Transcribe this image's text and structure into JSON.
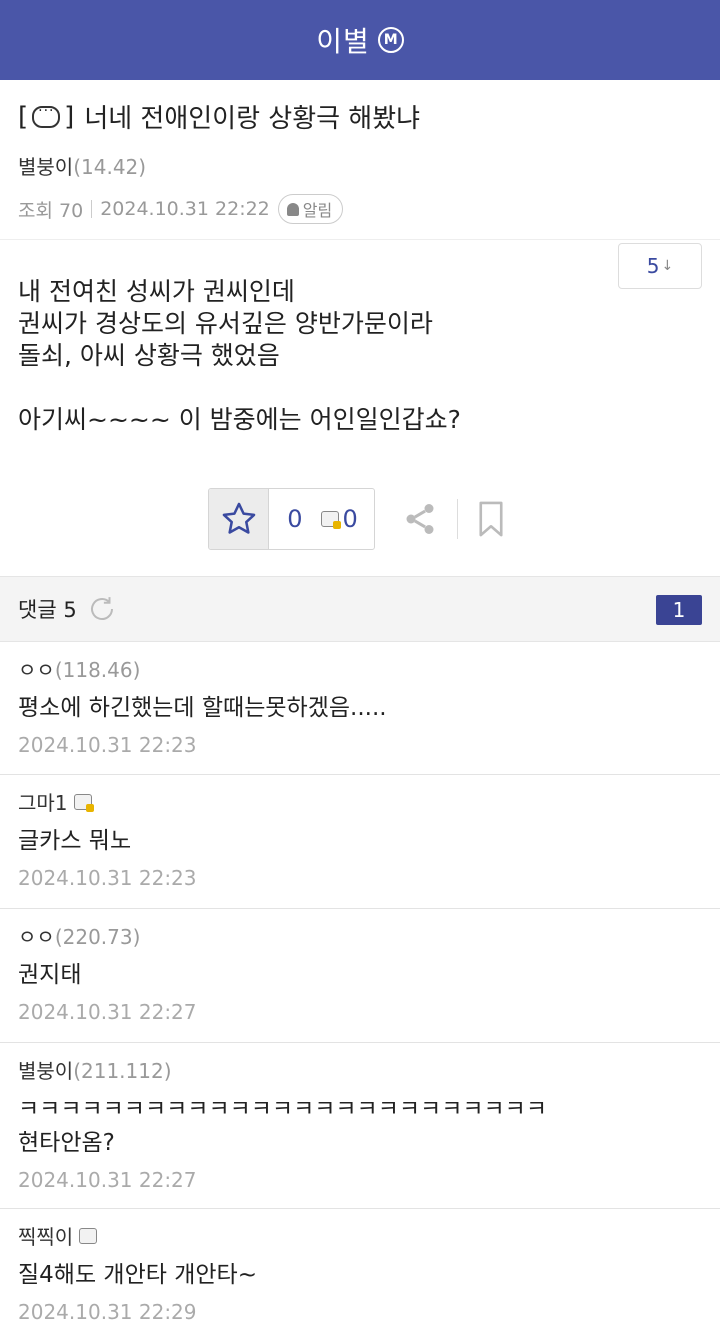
{
  "header": {
    "title": "이별",
    "badge": "M"
  },
  "post": {
    "title_bracket_open": "[",
    "title_bracket_close": "]",
    "title": "너네 전애인이랑 상황극 해봤냐",
    "author": "별붕이",
    "author_ip": "(14.42)",
    "views": "조회 70",
    "datetime": "2024.10.31 22:22",
    "alarm_label": "알림",
    "comment_jump": "5",
    "body_lines": [
      "내 전여친 성씨가 권씨인데",
      "권씨가 경상도의 유서깊은 양반가문이라",
      "돌쇠, 아씨 상황극 했었음"
    ],
    "body_last": "아기씨~~~~ 이 밤중에는 어인일인갑쇼?",
    "recommend_count": "0",
    "fixed_recommend_count": "0"
  },
  "comments_bar": {
    "label": "댓글 5",
    "page": "1"
  },
  "comments": [
    {
      "nick": "ㅇㅇ",
      "ip": "(118.46)",
      "icon": "",
      "text": "평소에 하긴했는데 할때는못하겠음.....",
      "date": "2024.10.31 22:23"
    },
    {
      "nick": "그마1",
      "ip": "",
      "icon": "gold",
      "text": "글카스 뭐노",
      "date": "2024.10.31 22:23"
    },
    {
      "nick": "ㅇㅇ",
      "ip": "(220.73)",
      "icon": "",
      "text": "권지태",
      "date": "2024.10.31 22:27"
    },
    {
      "nick": "별붕이",
      "ip": "(211.112)",
      "icon": "",
      "text": "ㅋㅋㅋㅋㅋㅋㅋㅋㅋㅋㅋㅋㅋㅋㅋㅋㅋㅋㅋㅋㅋㅋㅋㅋㅋ\n현타안옴?",
      "date": "2024.10.31 22:27"
    },
    {
      "nick": "찍찍이",
      "ip": "",
      "icon": "gray",
      "text": "질4해도 개안타 개안타~",
      "date": "2024.10.31 22:29"
    }
  ]
}
